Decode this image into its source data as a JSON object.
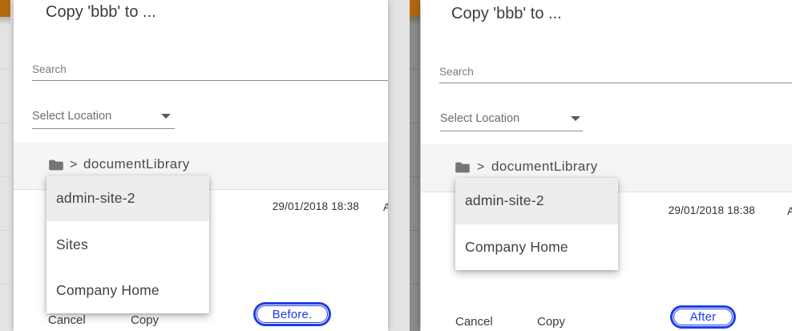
{
  "colors": {
    "toolbar_orange": "#b2690f",
    "annotation_blue": "#1f3ce8",
    "backdrop_light": "#e3e3e3",
    "backdrop_dark": "#8c8c8c"
  },
  "panels": [
    {
      "badge_label": "Before.",
      "dialog": {
        "title": "Copy 'bbb' to ...",
        "search_placeholder": "Search",
        "location_placeholder": "Select Location",
        "breadcrumb_separator": ">",
        "breadcrumb_current": "documentLibrary",
        "options": [
          "admin-site-2",
          "Sites",
          "Company Home"
        ],
        "selected_option": "admin-site-2",
        "row_modified_date": "29/01/2018 18:38",
        "row_clipped_text": "A",
        "cancel_label": "Cancel",
        "copy_label": "Copy"
      }
    },
    {
      "badge_label": "After",
      "dialog": {
        "title": "Copy 'bbb' to ...",
        "search_placeholder": "Search",
        "location_placeholder": "Select Location",
        "breadcrumb_separator": ">",
        "breadcrumb_current": "documentLibrary",
        "options": [
          "admin-site-2",
          "Company Home"
        ],
        "selected_option": "admin-site-2",
        "row_modified_date": "29/01/2018 18:38",
        "row_clipped_text": "A",
        "cancel_label": "Cancel",
        "copy_label": "Copy"
      }
    }
  ]
}
